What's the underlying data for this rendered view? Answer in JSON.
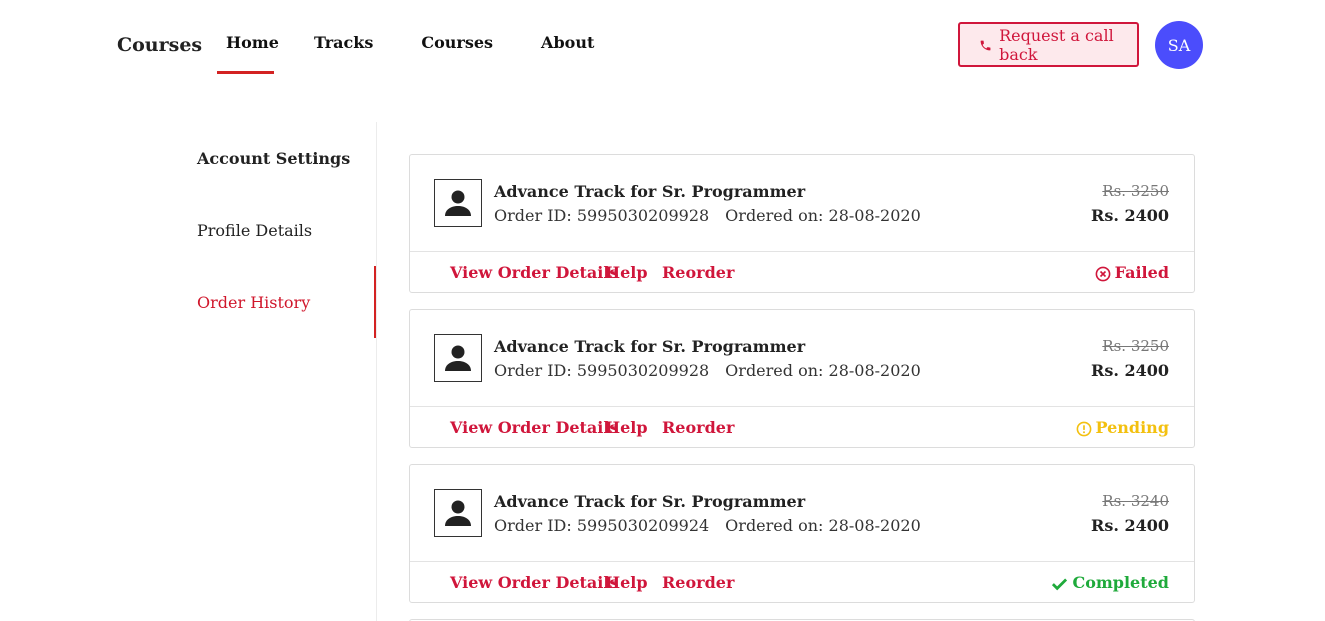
{
  "header": {
    "brand": "Courses",
    "nav": [
      {
        "label": "Home",
        "active": true
      },
      {
        "label": "Tracks",
        "active": false
      },
      {
        "label": "Courses",
        "active": false
      },
      {
        "label": "About",
        "active": false
      }
    ],
    "callback_label": "Request a call back",
    "callback_icon": "phone-icon",
    "avatar_initials": "SA"
  },
  "sidebar": {
    "heading": "Account Settings",
    "items": [
      {
        "label": "Profile Details",
        "active": false
      },
      {
        "label": "Order History",
        "active": true
      }
    ]
  },
  "orders": [
    {
      "title": "Advance Track for Sr. Programmer",
      "order_id_label": "Order ID: 5995030209928",
      "ordered_on_label": "Ordered on: 28-08-2020",
      "old_price": "Rs. 3250",
      "new_price": "Rs. 2400",
      "actions": {
        "details": "View Order Details",
        "help": "Help",
        "reorder": "Reorder"
      },
      "status": "Failed",
      "status_icon": "x-circle-icon"
    },
    {
      "title": "Advance Track for Sr. Programmer",
      "order_id_label": "Order ID: 5995030209928",
      "ordered_on_label": "Ordered on: 28-08-2020",
      "old_price": "Rs. 3250",
      "new_price": "Rs. 2400",
      "actions": {
        "details": "View Order Details",
        "help": "Help",
        "reorder": "Reorder"
      },
      "status": "Pending",
      "status_icon": "exclamation-circle-icon"
    },
    {
      "title": "Advance Track for Sr. Programmer",
      "order_id_label": "Order ID: 5995030209924",
      "ordered_on_label": "Ordered on: 28-08-2020",
      "old_price": "Rs. 3240",
      "new_price": "Rs. 2400",
      "actions": {
        "details": "View Order Details",
        "help": "Help",
        "reorder": "Reorder"
      },
      "status": "Completed",
      "status_icon": "check-icon"
    }
  ],
  "colors": {
    "accent_red": "#d0163b",
    "avatar_blue": "#4b4dfc",
    "failed": "#d0163b",
    "pending": "#f3c00f",
    "completed": "#1faa3b"
  }
}
